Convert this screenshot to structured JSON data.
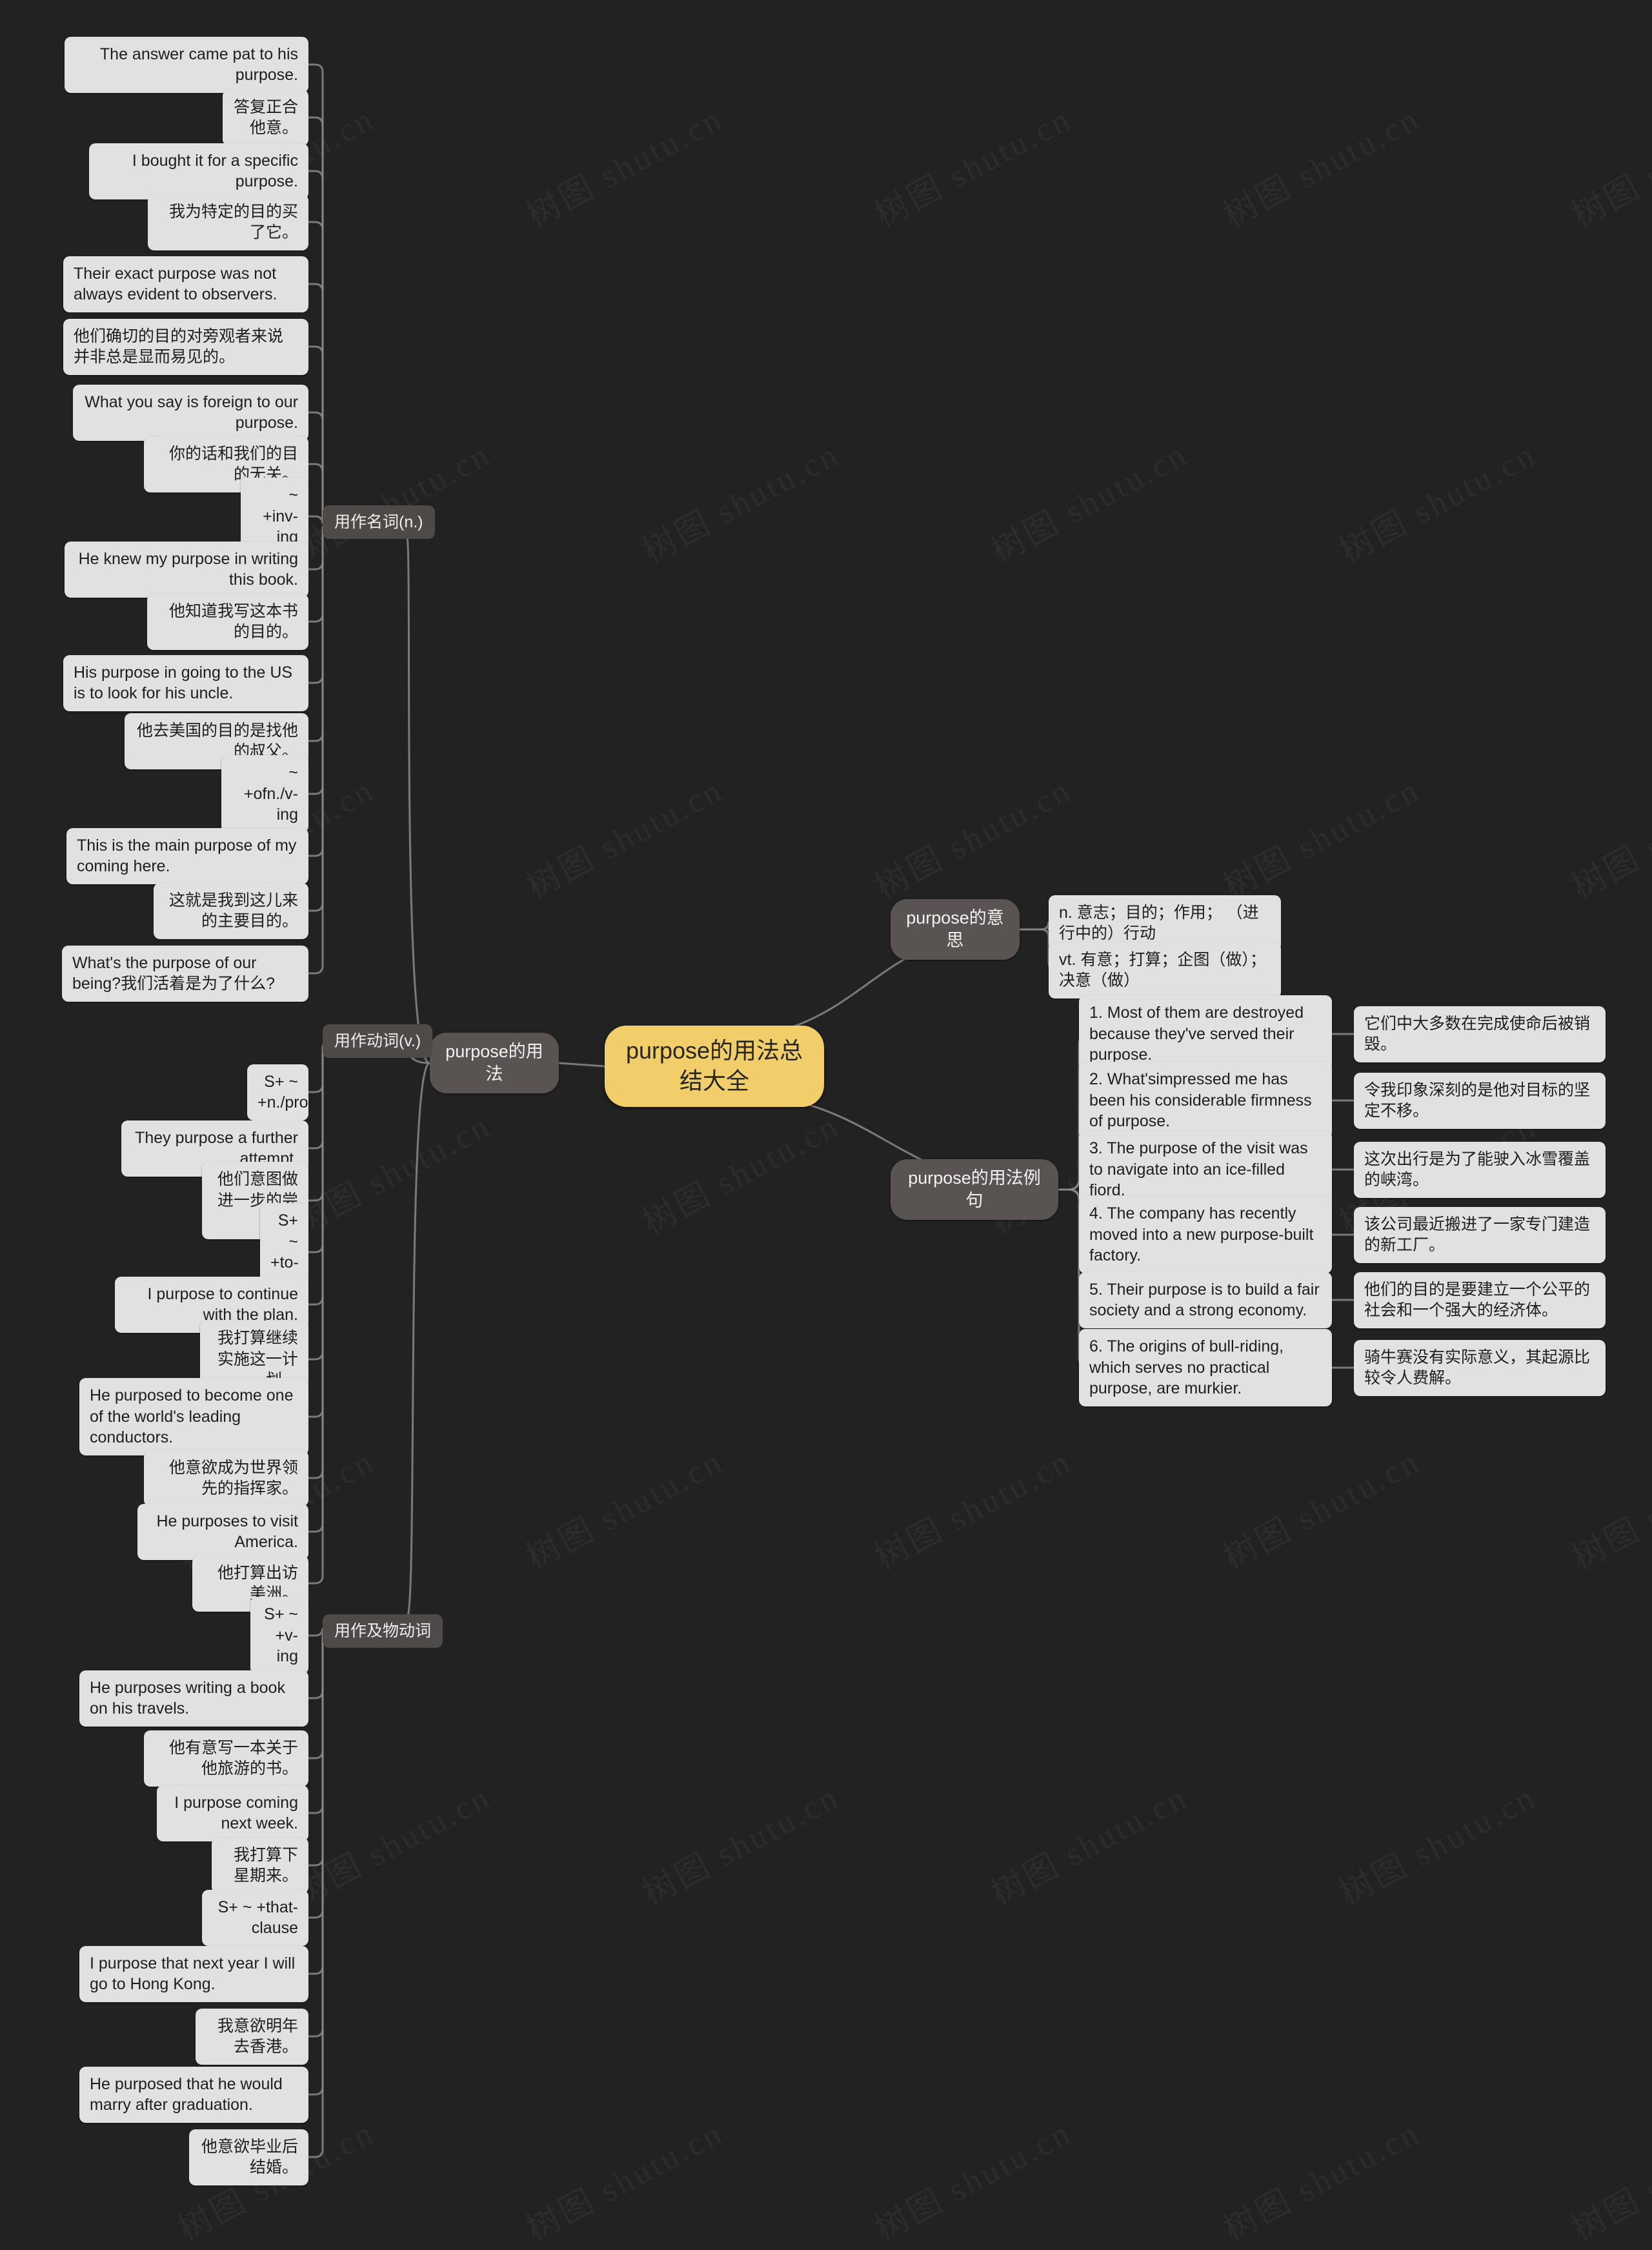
{
  "meta": {
    "background_color": "#222222",
    "root_color": "#f2ce6a",
    "branch_color": "#595451",
    "leaf_color": "#e1e1e1",
    "link_color": "#8a8a8a",
    "watermark_text": "树图 shutu.cn"
  },
  "root": {
    "label": "purpose的用法总结大全"
  },
  "branches": {
    "usage": {
      "label": "purpose的用法"
    },
    "meaning": {
      "label": "purpose的意思"
    },
    "examples": {
      "label": "purpose的用法例句"
    }
  },
  "subbranches": {
    "noun": {
      "label": "用作名词(n.)"
    },
    "verb": {
      "label": "用作动词(v.)"
    },
    "transitive": {
      "label": "用作及物动词"
    }
  },
  "meaning_items": [
    {
      "text": "n. 意志；目的；作用； （进行中的）行动"
    },
    {
      "text": "vt. 有意；打算；企图（做）；决意（做）"
    }
  ],
  "example_pairs": [
    {
      "en": "1. Most of them are destroyed because they've served their purpose.",
      "zh": "它们中大多数在完成使命后被销毁。"
    },
    {
      "en": "2. What'simpressed me has been his considerable firmness of purpose.",
      "zh": "令我印象深刻的是他对目标的坚定不移。"
    },
    {
      "en": "3. The purpose of the visit was to navigate into an ice-filled fiord.",
      "zh": "这次出行是为了能驶入冰雪覆盖的峡湾。"
    },
    {
      "en": "4. The company has recently moved into a new purpose-built factory.",
      "zh": "该公司最近搬进了一家专门建造的新工厂。"
    },
    {
      "en": "5. Their purpose is to build a fair society and a strong economy.",
      "zh": "他们的目的是要建立一个公平的社会和一个强大的经济体。"
    },
    {
      "en": "6. The origins of bull-riding, which serves no practical purpose, are murkier.",
      "zh": "骑牛赛没有实际意义，其起源比较令人费解。"
    }
  ],
  "noun_items": [
    {
      "text": "The answer came pat to his purpose."
    },
    {
      "text": "答复正合他意。"
    },
    {
      "text": "I bought it for a specific purpose."
    },
    {
      "text": "我为特定的目的买了它。"
    },
    {
      "text": "Their exact purpose was not always evident to observers."
    },
    {
      "text": "他们确切的目的对旁观者来说并非总是显而易见的。"
    },
    {
      "text": "What you say is foreign to our purpose."
    },
    {
      "text": "你的话和我们的目的无关。"
    },
    {
      "text": "~ +inv-ing"
    },
    {
      "text": "He knew my purpose in writing this book."
    },
    {
      "text": "他知道我写这本书的目的。"
    },
    {
      "text": "His purpose in going to the US is to look for his uncle."
    },
    {
      "text": "他去美国的目的是找他的叔父。"
    },
    {
      "text": "~ +ofn./v-ing"
    },
    {
      "text": "This is the main purpose of my coming here."
    },
    {
      "text": "这就是我到这儿来的主要目的。"
    },
    {
      "text": "What's the purpose of our being?我们活着是为了什么?"
    }
  ],
  "verb_items": [
    {
      "text": "S+ ~ +n./pron."
    },
    {
      "text": "They purpose a further attempt."
    },
    {
      "text": "他们意图做进一步的尝试。"
    },
    {
      "text": "S+ ~ +to-v"
    },
    {
      "text": "I purpose to continue with the plan."
    },
    {
      "text": "我打算继续实施这一计划。"
    },
    {
      "text": "He purposed to become one of the world's leading conductors."
    },
    {
      "text": "他意欲成为世界领先的指挥家。"
    },
    {
      "text": "He purposes to visit America."
    },
    {
      "text": "他打算出访美洲。"
    },
    {
      "text": "S+ ~ +v-ing"
    },
    {
      "text": "He purposes writing a book on his travels."
    },
    {
      "text": "他有意写一本关于他旅游的书。"
    },
    {
      "text": "I purpose coming next week."
    },
    {
      "text": "我打算下星期来。"
    },
    {
      "text": "S+ ~ +that-clause"
    },
    {
      "text": "I purpose that next year I will go to Hong Kong."
    },
    {
      "text": "我意欲明年去香港。"
    },
    {
      "text": "He purposed that he would marry after graduation."
    },
    {
      "text": "他意欲毕业后结婚。"
    }
  ]
}
